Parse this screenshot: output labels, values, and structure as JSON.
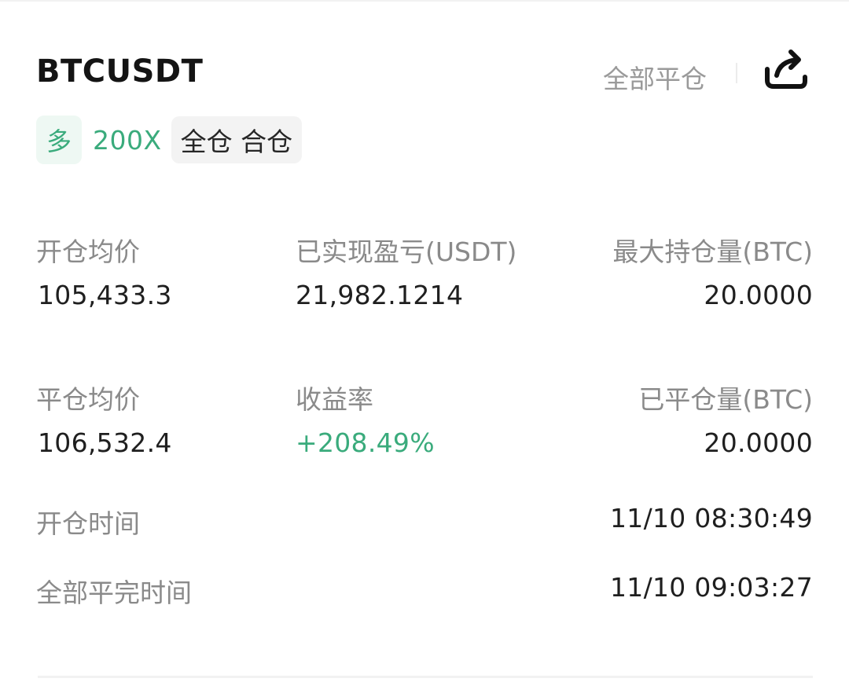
{
  "header": {
    "symbol": "BTCUSDT",
    "close_all_label": "全部平仓",
    "share_icon": "share-icon"
  },
  "badges": {
    "side": "多",
    "leverage": "200X",
    "mode": "全仓 合仓"
  },
  "stats": {
    "open_avg_price_label": "开仓均价",
    "open_avg_price": "105,433.3",
    "realized_pnl_label": "已实现盈亏(USDT)",
    "realized_pnl": "21,982.1214",
    "max_position_label": "最大持仓量(BTC)",
    "max_position": "20.0000",
    "close_avg_price_label": "平仓均价",
    "close_avg_price": "106,532.4",
    "roi_label": "收益率",
    "roi": "+208.49%",
    "closed_amount_label": "已平仓量(BTC)",
    "closed_amount": "20.0000"
  },
  "times": {
    "open_time_label": "开仓时间",
    "open_time": "11/10 08:30:49",
    "full_close_time_label": "全部平完时间",
    "full_close_time": "11/10 09:03:27"
  },
  "colors": {
    "accent_green": "#3aab7c",
    "muted_text": "#8a8a8a",
    "primary_text": "#1f1f1f"
  }
}
